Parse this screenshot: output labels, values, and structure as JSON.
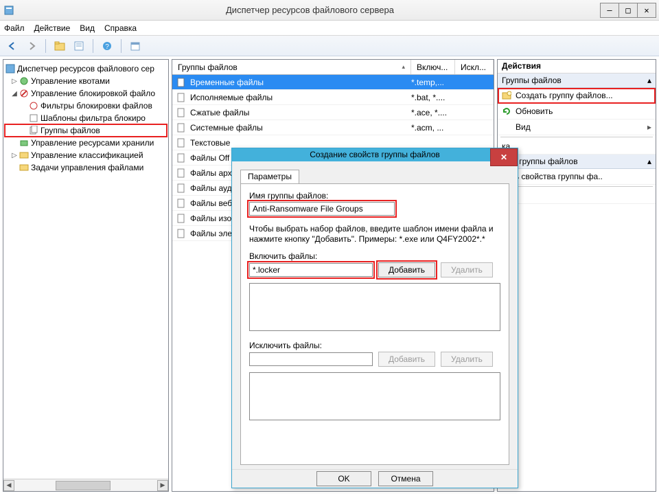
{
  "window": {
    "title": "Диспетчер ресурсов файлового сервера"
  },
  "menu": {
    "file": "Файл",
    "action": "Действие",
    "view": "Вид",
    "help": "Справка"
  },
  "tree": {
    "root": "Диспетчер ресурсов файлового сер",
    "quota": "Управление квотами",
    "blocking": "Управление блокировкой файло",
    "filters": "Фильтры блокировки файлов",
    "templates": "Шаблоны фильтра блокиро",
    "groups": "Группы файлов",
    "storage": "Управление ресурсами хранили",
    "classification": "Управление классификацией",
    "tasks": "Задачи управления файлами"
  },
  "list": {
    "headers": {
      "name": "Группы файлов",
      "include": "Включ...",
      "exclude": "Искл..."
    },
    "rows": [
      {
        "name": "Временные файлы",
        "inc": "*.temp,..."
      },
      {
        "name": "Исполняемые файлы",
        "inc": "*.bat, *...."
      },
      {
        "name": "Сжатые файлы",
        "inc": "*.ace, *...."
      },
      {
        "name": "Системные файлы",
        "inc": "*.acm, ..."
      },
      {
        "name": "Текстовые",
        "inc": ""
      },
      {
        "name": "Файлы Off",
        "inc": ""
      },
      {
        "name": "Файлы арх",
        "inc": ""
      },
      {
        "name": "Файлы ауд",
        "inc": ""
      },
      {
        "name": "Файлы веб",
        "inc": ""
      },
      {
        "name": "Файлы изо",
        "inc": ""
      },
      {
        "name": "Файлы эле",
        "inc": ""
      }
    ]
  },
  "actions": {
    "header": "Действия",
    "section1": "Группы файлов",
    "create": "Создать группу файлов...",
    "refresh": "Обновить",
    "view": "Вид",
    "help_suffix": "ка",
    "section2_suffix": "ные группы файлов",
    "edit_suffix": "нить свойства группы фа..",
    "help2_suffix": "ка"
  },
  "dialog": {
    "title": "Создание свойств группы файлов",
    "tab": "Параметры",
    "name_label": "Имя группы файлов:",
    "name_value": "Anti-Ransomware File Groups",
    "hint": "Чтобы выбрать набор файлов, введите шаблон имени файла и нажмите кнопку \"Добавить\". Примеры: *.exe или Q4FY2002*.*",
    "include_label": "Включить файлы:",
    "include_value": "*.locker",
    "add": "Добавить",
    "remove": "Удалить",
    "exclude_label": "Исключить файлы:",
    "ok": "OK",
    "cancel": "Отмена"
  }
}
